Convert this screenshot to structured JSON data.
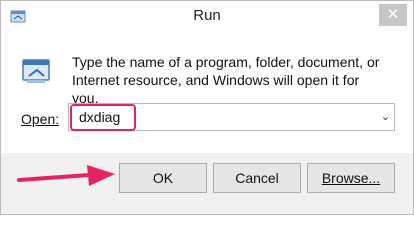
{
  "window": {
    "title": "Run",
    "close_glyph": "✕"
  },
  "dialog": {
    "description": "Type the name of a program, folder, document, or Internet resource, and Windows will open it for you.",
    "open_label": "Open:",
    "open_value": "dxdiag",
    "dropdown_glyph": "⌄"
  },
  "buttons": {
    "ok": "OK",
    "cancel": "Cancel",
    "browse": "Browse..."
  },
  "annotation": {
    "color": "#e5245f"
  }
}
